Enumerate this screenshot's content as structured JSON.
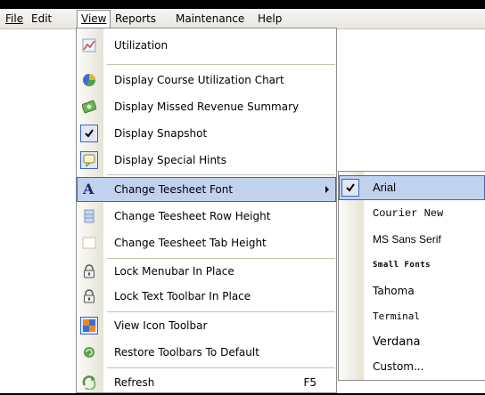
{
  "menubar": {
    "items": [
      {
        "label": "File"
      },
      {
        "label": "Edit"
      },
      {
        "label": "View"
      },
      {
        "label": "Reports"
      },
      {
        "label": "Maintenance"
      },
      {
        "label": "Help"
      }
    ]
  },
  "view_menu": {
    "items": [
      {
        "label": "Utilization",
        "icon": "chart-icon"
      },
      {
        "label": "Display Course Utilization Chart",
        "icon": "pie-chart-icon"
      },
      {
        "label": "Display Missed Revenue Summary",
        "icon": "money-icon"
      },
      {
        "label": "Display Snapshot",
        "icon": "check-icon",
        "checked": true
      },
      {
        "label": "Display Special Hints",
        "icon": "speech-bubble-icon"
      },
      {
        "label": "Change Teesheet Font",
        "icon": "font-icon"
      },
      {
        "label": "Change Teesheet Row Height",
        "icon": "row-height-icon"
      },
      {
        "label": "Change Teesheet Tab Height",
        "icon": "tab-height-icon"
      },
      {
        "label": "Lock Menubar In Place",
        "icon": "lock-icon"
      },
      {
        "label": "Lock Text Toolbar In Place",
        "icon": "lock-icon"
      },
      {
        "label": "View Icon Toolbar",
        "icon": "toolbar-icon"
      },
      {
        "label": "Restore Toolbars To Default",
        "icon": "restore-icon"
      },
      {
        "label": "Refresh",
        "icon": "refresh-icon",
        "shortcut": "F5"
      }
    ]
  },
  "font_submenu": {
    "items": [
      {
        "label": "Arial",
        "checked": true
      },
      {
        "label": "Courier New"
      },
      {
        "label": "MS Sans Serif"
      },
      {
        "label": "Small Fonts"
      },
      {
        "label": "Tahoma"
      },
      {
        "label": "Terminal"
      },
      {
        "label": "Verdana"
      },
      {
        "label": "Custom..."
      }
    ]
  },
  "colors": {
    "highlight": "#c1d2ee",
    "highlight_border": "#316ac5",
    "gutter": "#e6e3d6"
  }
}
